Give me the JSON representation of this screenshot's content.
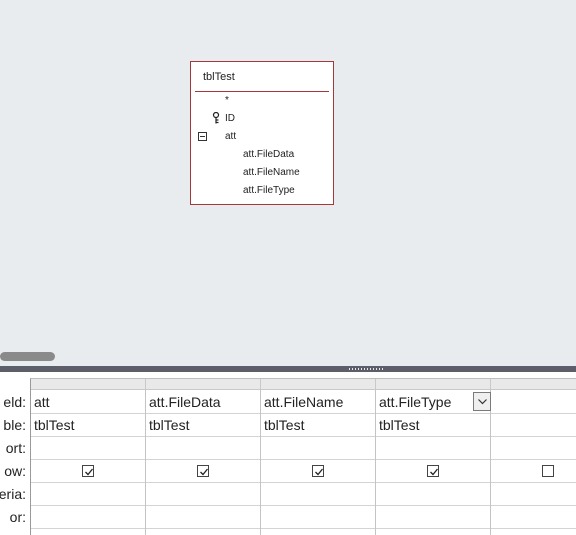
{
  "design": {
    "table": {
      "title": "tblTest",
      "fields": [
        {
          "label": "*"
        },
        {
          "label": "ID",
          "icon": "key-icon"
        },
        {
          "label": "att",
          "icon": "collapse-icon"
        },
        {
          "label": "att.FileData"
        },
        {
          "label": "att.FileName"
        },
        {
          "label": "att.FileType"
        }
      ]
    }
  },
  "grid": {
    "row_labels": [
      "eld:",
      "ble:",
      "ort:",
      "ow:",
      "eria:",
      "or:"
    ],
    "columns": [
      {
        "field": "att",
        "table": "tblTest",
        "show": true
      },
      {
        "field": "att.FileData",
        "table": "tblTest",
        "show": true
      },
      {
        "field": "att.FileName",
        "table": "tblTest",
        "show": true
      },
      {
        "field": "att.FileType",
        "table": "tblTest",
        "show": true,
        "has_dropdown": true
      },
      {
        "field": "",
        "table": "",
        "show": false
      }
    ]
  }
}
